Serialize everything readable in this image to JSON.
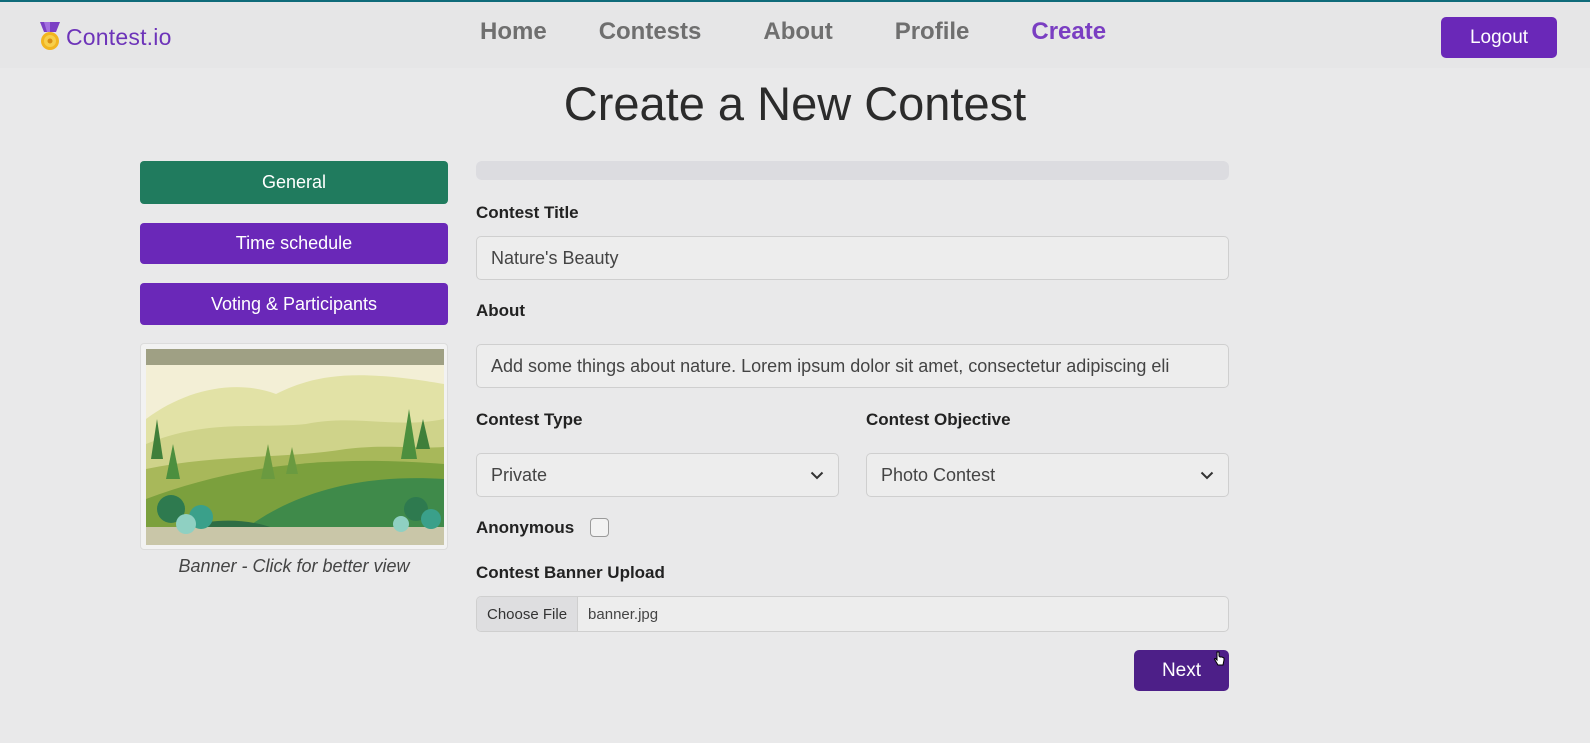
{
  "brand": {
    "name": "Contest.io",
    "logo_icon": "medal-icon"
  },
  "nav": {
    "home": "Home",
    "contests": "Contests",
    "about": "About",
    "profile": "Profile",
    "create": "Create",
    "active": "Create",
    "logout": "Logout"
  },
  "page": {
    "title": "Create a New Contest"
  },
  "sidebar": {
    "general": "General",
    "time_schedule": "Time schedule",
    "voting_participants": "Voting & Participants",
    "banner_caption": "Banner - Click for better view"
  },
  "progress": {
    "value": 0
  },
  "form": {
    "contest_title_label": "Contest Title",
    "contest_title_value": "Nature's Beauty",
    "about_label": "About",
    "about_value": "Add some things about nature. Lorem ipsum dolor sit amet, consectetur adipiscing eli",
    "contest_type_label": "Contest Type",
    "contest_type_value": "Private",
    "contest_objective_label": "Contest Objective",
    "contest_objective_value": "Photo Contest",
    "anonymous_label": "Anonymous",
    "anonymous_checked": false,
    "banner_upload_label": "Contest Banner Upload",
    "choose_file": "Choose File",
    "file_name": "banner.jpg",
    "next": "Next"
  },
  "colors": {
    "brand_purple": "#6a28b8",
    "active_nav": "#7a3ec2",
    "general_green": "#207b5e",
    "next_dark_purple": "#4d1f88"
  }
}
